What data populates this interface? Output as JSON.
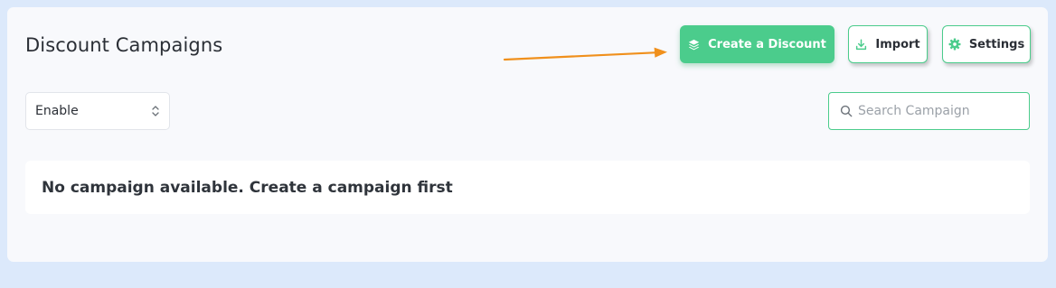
{
  "header": {
    "title": "Discount Campaigns",
    "buttons": {
      "create": {
        "label": "Create a Discount",
        "icon": "layers-icon"
      },
      "import": {
        "label": "Import",
        "icon": "download-icon"
      },
      "settings": {
        "label": "Settings",
        "icon": "gear-icon"
      }
    }
  },
  "filters": {
    "status_select": {
      "value": "Enable",
      "icon": "chevron-up-down-icon"
    },
    "search": {
      "placeholder": "Search Campaign",
      "value": "",
      "icon": "search-icon"
    }
  },
  "main": {
    "empty_message": "No campaign available. Create a campaign first"
  },
  "annotation": {
    "arrow_color": "#f0901c"
  },
  "colors": {
    "accent": "#4bcc8c",
    "page_background": "#dce9fb",
    "panel_background": "#f8f9fc",
    "text": "#2b2f36"
  }
}
